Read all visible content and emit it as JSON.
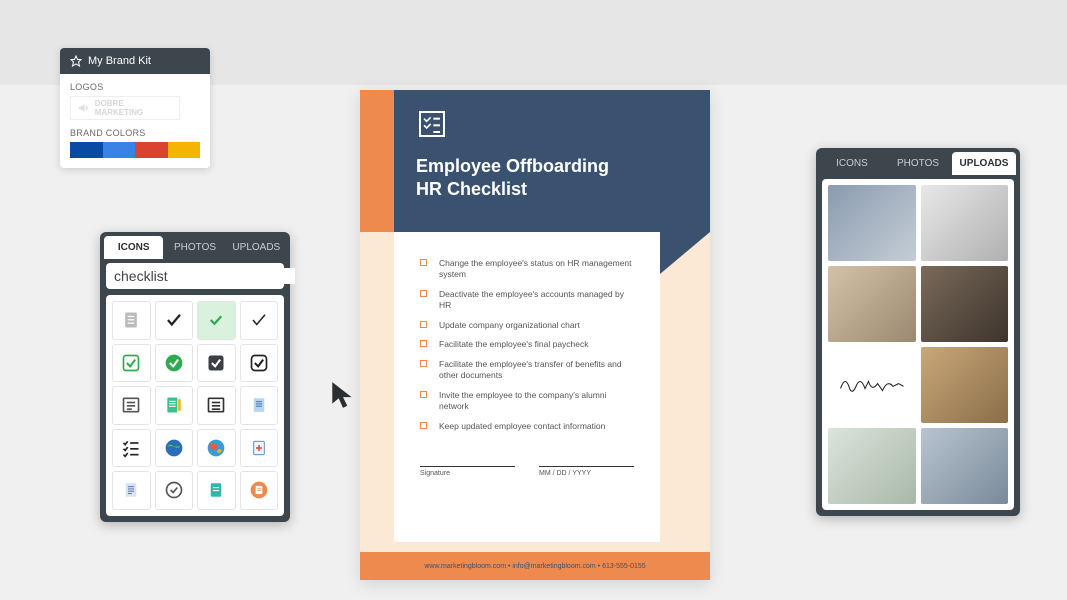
{
  "brand_kit": {
    "title": "My Brand Kit",
    "logos_label": "LOGOS",
    "logo_text": "DOBRE MARKETING",
    "colors_label": "BRAND COLORS",
    "swatches": [
      "#0a4aa3",
      "#3b82e6",
      "#d9432f",
      "#f4b400"
    ]
  },
  "icons_panel": {
    "tabs": [
      "ICONS",
      "PHOTOS",
      "UPLOADS"
    ],
    "active_tab": 0,
    "search_value": "checklist",
    "icons": [
      "clipboard-list-grey",
      "checkmark-black",
      "checkbox-green-filled",
      "checkmark-thin",
      "checkbox-green-outline",
      "check-circle-green",
      "checkbox-dark-filled",
      "checkbox-outline",
      "list-lines",
      "clipboard-pencil",
      "list-lines-dark",
      "document-blue",
      "bullet-list-check",
      "globe-blue",
      "globe-color",
      "clipboard-plus",
      "clipboard-lines-blue",
      "check-circle-outline",
      "clipboard-teal",
      "clipboard-orange"
    ]
  },
  "document": {
    "title_line1": "Employee Offboarding",
    "title_line2": "HR Checklist",
    "items": [
      "Change the employee's status on HR management system",
      "Deactivate the employee's accounts managed by HR",
      "Update company organizational chart",
      "Facilitate the employee's final paycheck",
      "Facilitate the employee's transfer of benefits and other documents",
      "Invite the employee to the company's alumni network",
      "Keep updated employee contact information"
    ],
    "signature_label": "Signature",
    "date_label": "MM / DD / YYYY",
    "footer": "www.marketingbloom.com  •  info@marketingbloom.com  •  613-555-0155"
  },
  "uploads_panel": {
    "tabs": [
      "ICONS",
      "PHOTOS",
      "UPLOADS"
    ],
    "active_tab": 2,
    "thumbs": [
      "office-meeting",
      "desk-flatlay",
      "woman-laptop",
      "man-desk-side",
      "signature-script",
      "dog-laptop",
      "plant-keyboard",
      "two-people-laptop"
    ]
  }
}
